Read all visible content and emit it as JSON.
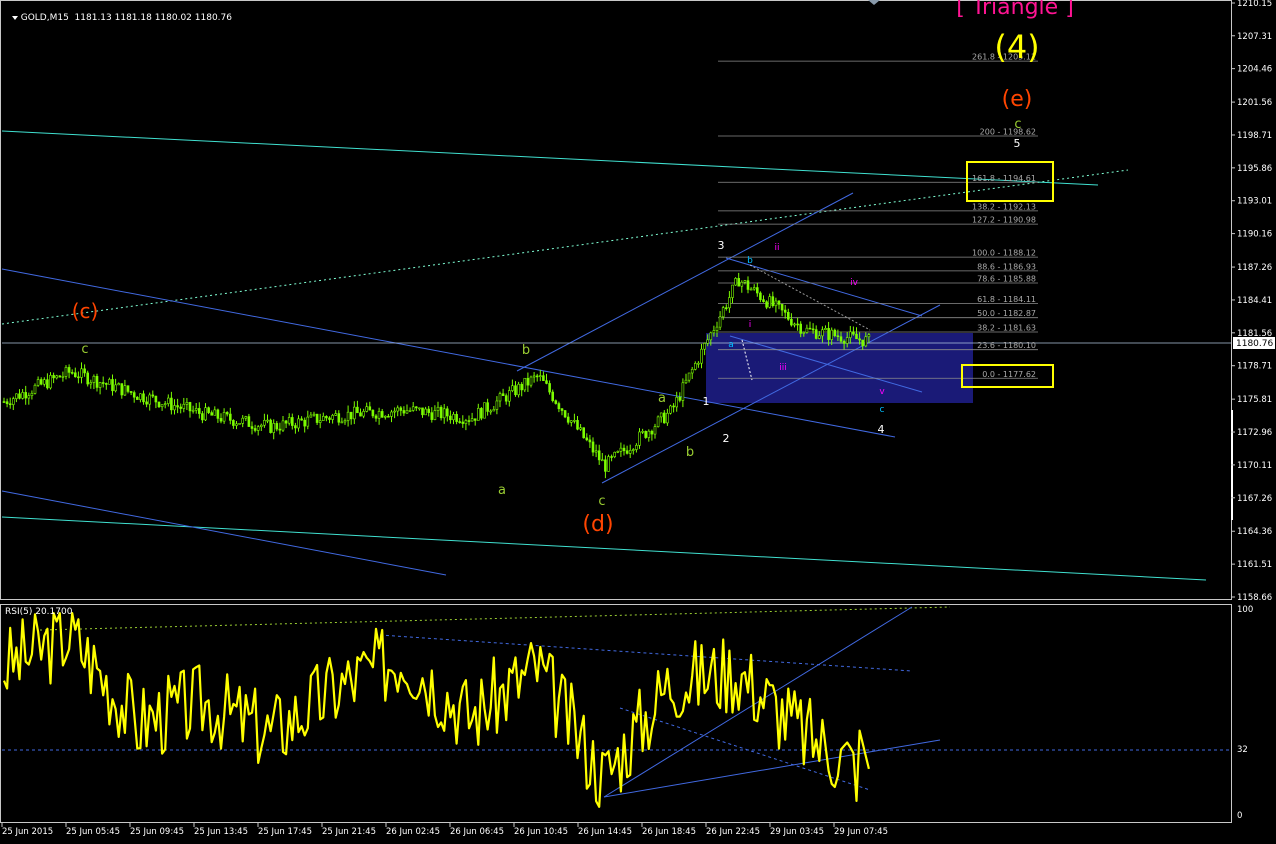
{
  "main": {
    "symbol_header": "GOLD,M15  1181.13 1181.18 1180.02 1180.76",
    "current_price": "1180.76",
    "y_ticks": [
      "1210.15",
      "1207.31",
      "1204.46",
      "1201.56",
      "1198.71",
      "1195.86",
      "1193.01",
      "1190.16",
      "1187.26",
      "1184.41",
      "1181.56",
      "1178.71",
      "1175.81",
      "1172.96",
      "1170.11",
      "1167.26",
      "1164.36",
      "1161.51",
      "1158.66"
    ],
    "title_label": "[ Triangle ]",
    "fib_levels": [
      {
        "ratio": "261.8",
        "price": "1205.11",
        "label": "261.8 - 1205.11"
      },
      {
        "ratio": "200",
        "price": "1198.62",
        "label": "200 - 1198.62"
      },
      {
        "ratio": "161.8",
        "price": "1194.61",
        "label": "161.8 - 1194.61"
      },
      {
        "ratio": "138.2",
        "price": "1192.13",
        "label": "138.2 - 1192.13"
      },
      {
        "ratio": "127.2",
        "price": "1190.98",
        "label": "127.2 - 1190.98"
      },
      {
        "ratio": "100.0",
        "price": "1188.12",
        "label": "100.0 - 1188.12"
      },
      {
        "ratio": "88.6",
        "price": "1186.93",
        "label": "88.6 - 1186.93"
      },
      {
        "ratio": "78.6",
        "price": "1185.88",
        "label": "78.6 - 1185.88"
      },
      {
        "ratio": "61.8",
        "price": "1184.11",
        "label": "61.8 - 1184.11"
      },
      {
        "ratio": "50.0",
        "price": "1182.87",
        "label": "50.0 - 1182.87"
      },
      {
        "ratio": "38.2",
        "price": "1181.63",
        "label": "38.2 - 1181.63"
      },
      {
        "ratio": "23.6",
        "price": "1180.10",
        "label": "23.6 - 1180.10"
      },
      {
        "ratio": "0.0",
        "price": "1177.62",
        "label": "0.0 - 1177.62"
      }
    ],
    "wave_labels": [
      {
        "text": "(4)",
        "color": "#ffff00"
      },
      {
        "text": "(e)",
        "color": "#ff4500"
      },
      {
        "text": "c",
        "color": "#9acd32"
      },
      {
        "text": "5",
        "color": "#ffffff"
      },
      {
        "text": "(c)",
        "color": "#ff4500"
      },
      {
        "text": "c",
        "color": "#9acd32"
      },
      {
        "text": "b",
        "color": "#9acd32"
      },
      {
        "text": "a",
        "color": "#9acd32"
      },
      {
        "text": "c",
        "color": "#9acd32"
      },
      {
        "text": "(d)",
        "color": "#ff4500"
      },
      {
        "text": "a",
        "color": "#9acd32"
      },
      {
        "text": "b",
        "color": "#9acd32"
      },
      {
        "text": "1",
        "color": "#ffffff"
      },
      {
        "text": "2",
        "color": "#ffffff"
      },
      {
        "text": "3",
        "color": "#ffffff"
      },
      {
        "text": "4",
        "color": "#ffffff"
      },
      {
        "text": "b",
        "color": "#00bfff"
      },
      {
        "text": "a",
        "color": "#00bfff"
      },
      {
        "text": "c",
        "color": "#00bfff"
      },
      {
        "text": "i",
        "color": "#ff00ff"
      },
      {
        "text": "ii",
        "color": "#ff00ff"
      },
      {
        "text": "iii",
        "color": "#ff00ff"
      },
      {
        "text": "iv",
        "color": "#ff00ff"
      },
      {
        "text": "v",
        "color": "#ff00ff"
      }
    ]
  },
  "rsi": {
    "header": "RSI(5) 20.1700",
    "y_ticks": [
      "100",
      "32",
      "0"
    ]
  },
  "x_ticks": [
    "25 Jun 2015",
    "25 Jun 05:45",
    "25 Jun 09:45",
    "25 Jun 13:45",
    "25 Jun 17:45",
    "25 Jun 21:45",
    "26 Jun 02:45",
    "26 Jun 06:45",
    "26 Jun 10:45",
    "26 Jun 14:45",
    "26 Jun 18:45",
    "26 Jun 22:45",
    "29 Jun 03:45",
    "29 Jun 07:45"
  ],
  "colors": {
    "candles": "#7cfc00",
    "rsi": "#ffff00",
    "trend": "#4169e1",
    "cyan": "#40e0d0",
    "zone": "#1e1e8c"
  },
  "chart_data": [
    {
      "type": "candlestick",
      "title": "GOLD,M15",
      "ohlc_last": {
        "open": 1181.13,
        "high": 1181.18,
        "low": 1180.02,
        "close": 1180.76
      },
      "ylim": [
        1157.5,
        1211.0
      ],
      "x": [
        "25 Jun 2015",
        "25 Jun 05:45",
        "25 Jun 09:45",
        "25 Jun 13:45",
        "25 Jun 17:45",
        "25 Jun 21:45",
        "26 Jun 02:45",
        "26 Jun 06:45",
        "26 Jun 10:45",
        "26 Jun 14:45",
        "26 Jun 18:45",
        "26 Jun 22:45",
        "29 Jun 03:45",
        "29 Jun 07:45"
      ],
      "approx_close": [
        1175.6,
        1178.2,
        1176.2,
        1174.5,
        1173.4,
        1174.4,
        1174.9,
        1174.2,
        1177.8,
        1170.0,
        1174.8,
        1186.2,
        1181.8,
        1180.8
      ],
      "fib_retracement": [
        1177.62,
        1180.1,
        1181.63,
        1182.87,
        1184.11,
        1185.88,
        1186.93,
        1188.12,
        1190.98,
        1192.13,
        1194.61,
        1198.62,
        1205.11
      ]
    },
    {
      "type": "line",
      "title": "RSI(5) 20.1700",
      "ylim": [
        0,
        100
      ],
      "level": 32,
      "x": [
        "25 Jun 2015",
        "25 Jun 05:45",
        "25 Jun 09:45",
        "25 Jun 13:45",
        "25 Jun 17:45",
        "25 Jun 21:45",
        "26 Jun 02:45",
        "26 Jun 06:45",
        "26 Jun 10:45",
        "26 Jun 14:45",
        "26 Jun 18:45",
        "26 Jun 22:45",
        "29 Jun 03:45",
        "29 Jun 07:45"
      ],
      "values": [
        72,
        88,
        45,
        55,
        40,
        62,
        78,
        48,
        72,
        18,
        65,
        70,
        40,
        20.17
      ]
    }
  ]
}
